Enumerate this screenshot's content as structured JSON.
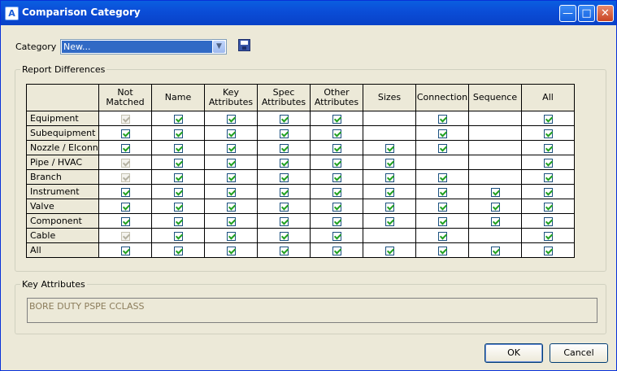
{
  "window": {
    "title": "Comparison Category",
    "app_icon": "A"
  },
  "category": {
    "label": "Category",
    "value": "New..."
  },
  "report_group": {
    "legend": "Report Differences"
  },
  "grid": {
    "columns": [
      {
        "l1": "Not",
        "l2": "Matched"
      },
      {
        "l1": "Name",
        "l2": ""
      },
      {
        "l1": "Key",
        "l2": "Attributes"
      },
      {
        "l1": "Spec",
        "l2": "Attributes"
      },
      {
        "l1": "Other",
        "l2": "Attributes"
      },
      {
        "l1": "Sizes",
        "l2": ""
      },
      {
        "l1": "Connection",
        "l2": ""
      },
      {
        "l1": "Sequence",
        "l2": ""
      },
      {
        "l1": "All",
        "l2": ""
      }
    ],
    "rows": [
      {
        "label": "Equipment",
        "cells": [
          "d",
          "c",
          "c",
          "c",
          "c",
          "",
          "c",
          "",
          "c"
        ]
      },
      {
        "label": "Subequipment",
        "cells": [
          "c",
          "c",
          "c",
          "c",
          "c",
          "",
          "c",
          "",
          "c"
        ]
      },
      {
        "label": "Nozzle / Elconn",
        "cells": [
          "c",
          "c",
          "c",
          "c",
          "c",
          "c",
          "c",
          "",
          "c"
        ]
      },
      {
        "label": "Pipe / HVAC",
        "cells": [
          "d",
          "c",
          "c",
          "c",
          "c",
          "c",
          "",
          "",
          "c"
        ]
      },
      {
        "label": "Branch",
        "cells": [
          "d",
          "c",
          "c",
          "c",
          "c",
          "c",
          "c",
          "",
          "c"
        ]
      },
      {
        "label": "Instrument",
        "cells": [
          "c",
          "c",
          "c",
          "c",
          "c",
          "c",
          "c",
          "c",
          "c"
        ]
      },
      {
        "label": "Valve",
        "cells": [
          "c",
          "c",
          "c",
          "c",
          "c",
          "c",
          "c",
          "c",
          "c"
        ]
      },
      {
        "label": "Component",
        "cells": [
          "c",
          "c",
          "c",
          "c",
          "c",
          "c",
          "c",
          "c",
          "c"
        ]
      },
      {
        "label": "Cable",
        "cells": [
          "d",
          "c",
          "c",
          "c",
          "c",
          "",
          "c",
          "",
          "c"
        ]
      },
      {
        "label": "All",
        "cells": [
          "c",
          "c",
          "c",
          "c",
          "c",
          "c",
          "c",
          "c",
          "c"
        ]
      }
    ]
  },
  "key_attributes": {
    "legend": "Key Attributes",
    "value": "BORE DUTY PSPE CCLASS"
  },
  "buttons": {
    "ok": "OK",
    "cancel": "Cancel"
  },
  "colors": {
    "titlebar": "#0b4ed8",
    "check": "#21a121",
    "selection": "#316ac5"
  }
}
